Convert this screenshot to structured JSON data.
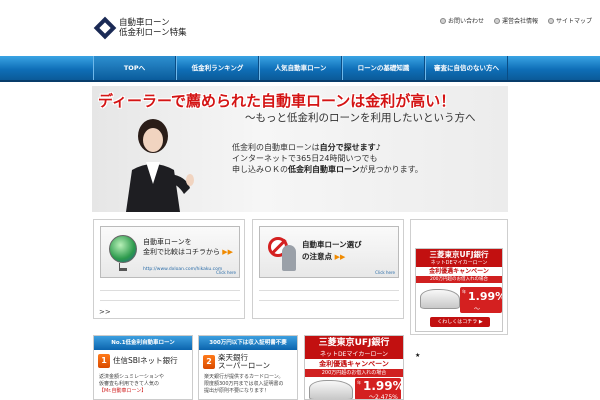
{
  "header": {
    "logo_line1": "自動車ローン",
    "logo_line2": "低金利ローン特集",
    "util_links": [
      "お問い合わせ",
      "運営会社情報",
      "サイトマップ"
    ]
  },
  "nav": {
    "items": [
      "TOPへ",
      "低金利ランキング",
      "人気自動車ローン",
      "ローンの基礎知識",
      "審査に自信のない方へ"
    ]
  },
  "hero": {
    "title": "ディーラーで薦められた自動車ローンは金利が高い！",
    "subtitle": "～もっと低金利のローンを利用したいという方へ",
    "line1_a": "低金利の自動車ローンは",
    "line1_b": "自分で探せます♪",
    "line2": "インターネットで365日24時間いつでも",
    "line3_a": "申し込みＯＫの",
    "line3_b": "低金利自動車ローン",
    "line3_c": "が見つかります。"
  },
  "box1": {
    "line1": "自動車ローンを",
    "line2": "金利で比較はコチラから",
    "url": "http://www.dxloan.com/hikaku.com",
    "click": "Click here",
    "more": ">>"
  },
  "box2": {
    "line1": "自動車ローン選び",
    "line2": "の注意点",
    "click": "Click here"
  },
  "bank_ad": {
    "bank": "三菱東京UFJ銀行",
    "product": "ネットDEマイカーローン",
    "campaign_a": "金利優遇",
    "campaign_b": "キャンペーン",
    "band": "200万円超のお借入れの場合",
    "rate_label": "年",
    "rate_big": "1.99%",
    "rate_small": "～2.475%",
    "button": "くわしくはコチラ ▶"
  },
  "promo1": {
    "header": "No.1低金利自動車ローン",
    "num": "1",
    "bank": "住信SBIネット銀行",
    "desc1": "返済金額シュミレーションや",
    "desc2": "仮審査も利用できて人気の",
    "desc3": "【Mr.自動車ローン】"
  },
  "promo2": {
    "header": "300万円以下は収入証明書不要",
    "num": "2",
    "bank1": "楽天銀行",
    "bank2": "スーパーローン",
    "desc1": "楽天銀行が提供するカードローン。",
    "desc2": "限度額300万円までは収入証明書の",
    "desc3": "提出が原則不要になります！"
  },
  "star": "★"
}
